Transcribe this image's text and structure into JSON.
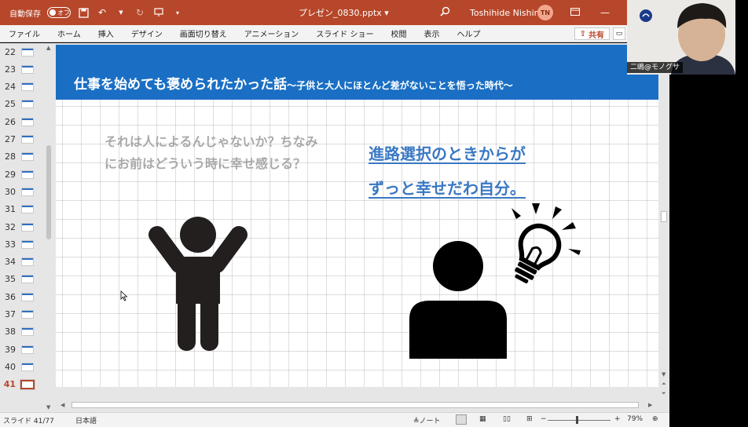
{
  "titlebar": {
    "autosave_label": "自動保存",
    "autosave_state": "オフ",
    "filename": "プレゼン_0830.pptx",
    "user_name": "Toshihide Nishima",
    "user_initials": "TN"
  },
  "ribbon": {
    "tabs": [
      "ファイル",
      "ホーム",
      "挿入",
      "デザイン",
      "画面切り替え",
      "アニメーション",
      "スライド ショー",
      "校閲",
      "表示",
      "ヘルプ"
    ],
    "share_label": "共有"
  },
  "thumbnails": {
    "numbers": [
      "22",
      "23",
      "24",
      "25",
      "26",
      "27",
      "28",
      "29",
      "30",
      "31",
      "32",
      "33",
      "34",
      "35",
      "36",
      "37",
      "38",
      "39",
      "40",
      "41"
    ],
    "active": "41"
  },
  "slide": {
    "title_main": "仕事を始めても褒められたかった話",
    "title_sub": "〜子供と大人にほとんど差がないことを悟った時代〜",
    "left_text": "それは人によるんじゃないか？ちなみにお前はどういう時に幸せ感じる？",
    "right_line1": "進路選択のときからが",
    "right_line2": "ずっと幸せだわ自分。"
  },
  "statusbar": {
    "slide_info": "スライド 41/77",
    "language": "日本語",
    "notes_label": "ノート",
    "zoom": "79%"
  },
  "webcam": {
    "name": "二嶋@モノグサ"
  },
  "colors": {
    "accent": "#b7472a",
    "header_blue": "#1a6fc4",
    "link_blue": "#3a78c3",
    "gray_text": "#a9a9a9",
    "figure": "#241f1f"
  }
}
